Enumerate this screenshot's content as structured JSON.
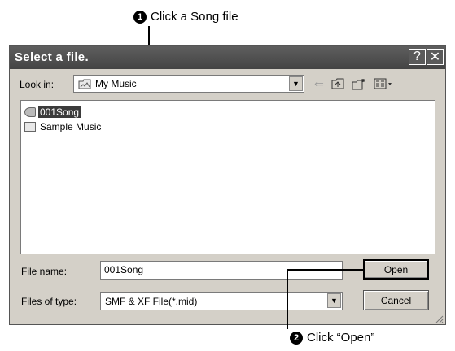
{
  "callouts": {
    "step1": {
      "number": "1",
      "text": "Click a Song file"
    },
    "step2": {
      "number": "2",
      "text": "Click “Open”"
    }
  },
  "dialog": {
    "title": "Select a file.",
    "help_glyph": "?",
    "close_glyph": "✕",
    "look_in": {
      "label": "Look in:",
      "value": "My Music",
      "icon": "folder-icon"
    },
    "toolbar": {
      "back_icon": "back-arrow-icon",
      "up_icon": "up-folder-icon",
      "new_folder_icon": "new-folder-icon",
      "view_icon": "view-menu-icon"
    },
    "files": [
      {
        "name": "001Song",
        "icon": "song-file-icon",
        "selected": true
      },
      {
        "name": "Sample Music",
        "icon": "folder-shortcut-icon",
        "selected": false
      }
    ],
    "file_name": {
      "label": "File name:",
      "value": "001Song"
    },
    "file_type": {
      "label": "Files of type:",
      "value": "SMF & XF File(*.mid)"
    },
    "buttons": {
      "open": "Open",
      "cancel": "Cancel"
    }
  }
}
